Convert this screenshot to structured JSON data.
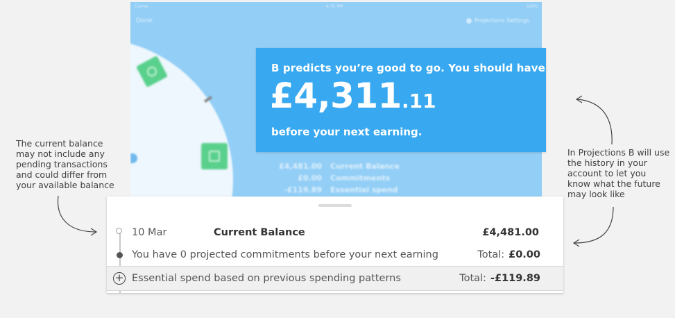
{
  "tablet": {
    "status": {
      "carrier": "Carrier",
      "time": "4:35 PM",
      "battery": "100%"
    },
    "nav": {
      "done": "Done",
      "settings": "Projections Settings"
    },
    "summary_rows": [
      {
        "amount": "£4,481.00",
        "label": "Current Balance"
      },
      {
        "amount": "£0.00",
        "label": "Commitments"
      },
      {
        "amount": "-£119.89",
        "label": "Essential spend"
      }
    ]
  },
  "card": {
    "line1": "B predicts you’re good to go. You should have",
    "amount_major": "£4,311",
    "amount_minor": ".11",
    "line2": "before your next earning.",
    "color": "#38a8f0"
  },
  "sheet": {
    "row1": {
      "date": "10 Mar",
      "title": "Current Balance",
      "amount": "£4,481.00"
    },
    "row2": {
      "desc": "You have 0 projected commitments before your next earning",
      "total_label": "Total:",
      "total_value": "£0.00"
    },
    "row3": {
      "desc": "Essential spend based on previous spending patterns",
      "total_label": "Total:",
      "total_value": "-£119.89"
    }
  },
  "annotations": {
    "left": "The current balance may not include any pending transactions and could differ from your available balance",
    "right": "In Projections B will use the history in your account to let you know what the future may look like"
  },
  "icons": [
    "wheel-tile-icon",
    "plus-circle-icon",
    "timeline-node-icon",
    "settings-icon"
  ]
}
